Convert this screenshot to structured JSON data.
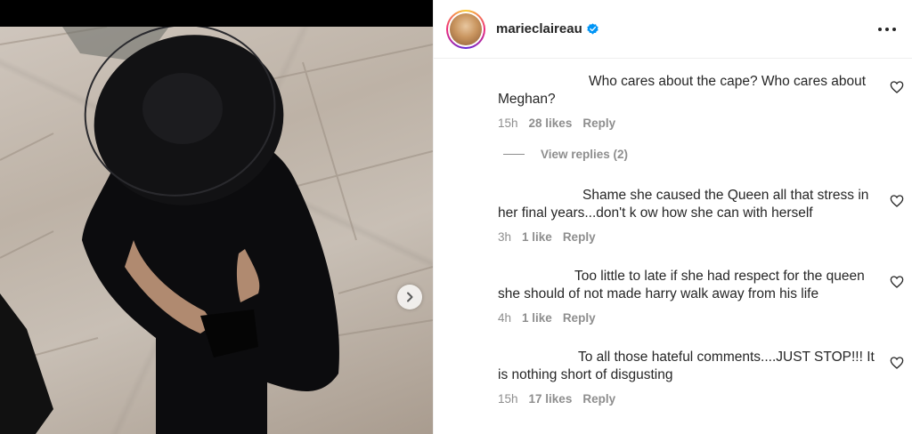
{
  "post": {
    "username": "marieclaireau"
  },
  "comments": [
    {
      "text": "Who cares about the cape? Who cares about Meghan?",
      "time": "15h",
      "likes": "28 likes",
      "reply": "Reply",
      "view_replies": "View replies (2)"
    },
    {
      "text": "Shame she caused the Queen all that stress in her final years...don't k ow how she can with herself",
      "time": "3h",
      "likes": "1 like",
      "reply": "Reply"
    },
    {
      "text": "Too little to late if she had respect for the queen she should of not made harry walk away from his life",
      "time": "4h",
      "likes": "1 like",
      "reply": "Reply"
    },
    {
      "text": "To all those hateful comments....JUST STOP!!! It is nothing short of disgusting",
      "time": "15h",
      "likes": "17 likes",
      "reply": "Reply"
    }
  ],
  "colors": {
    "verified": "#0095f6",
    "muted_text": "#8e8e8e",
    "primary_text": "#262626"
  },
  "icons": {
    "more": "more-options-icon",
    "verified": "verified-badge-icon",
    "like": "heart-icon",
    "next": "chevron-right-icon"
  }
}
